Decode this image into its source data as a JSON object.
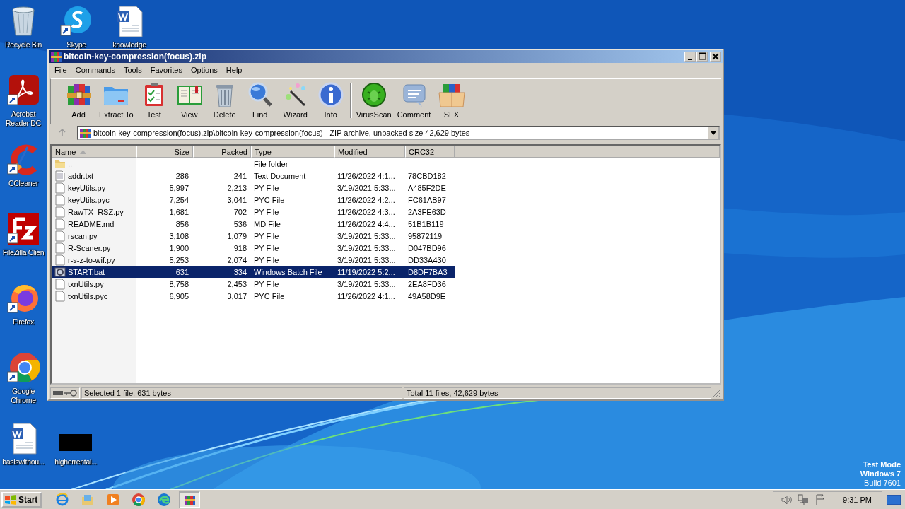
{
  "desktop_icons": [
    {
      "label": "Recycle Bin"
    },
    {
      "label": "Skype"
    },
    {
      "label": "knowledge"
    },
    {
      "label": "Acrobat Reader DC"
    },
    {
      "label": "CCleaner"
    },
    {
      "label": "FileZilla Clien"
    },
    {
      "label": "Firefox"
    },
    {
      "label": "Google Chrome"
    },
    {
      "label": "basiswithou..."
    },
    {
      "label": "higherrental..."
    }
  ],
  "window": {
    "title": "bitcoin-key-compression(focus).zip",
    "menu": [
      "File",
      "Commands",
      "Tools",
      "Favorites",
      "Options",
      "Help"
    ],
    "toolbar": [
      {
        "label": "Add"
      },
      {
        "label": "Extract To"
      },
      {
        "label": "Test"
      },
      {
        "label": "View"
      },
      {
        "label": "Delete"
      },
      {
        "label": "Find"
      },
      {
        "label": "Wizard"
      },
      {
        "label": "Info"
      },
      {
        "label": "VirusScan"
      },
      {
        "label": "Comment"
      },
      {
        "label": "SFX"
      }
    ],
    "address": "bitcoin-key-compression(focus).zip\\bitcoin-key-compression(focus) - ZIP archive, unpacked size 42,629 bytes",
    "columns": [
      "Name",
      "Size",
      "Packed",
      "Type",
      "Modified",
      "CRC32"
    ],
    "rows": [
      {
        "kind": "folder",
        "name": "..",
        "size": "",
        "packed": "",
        "type": "File folder",
        "modified": "",
        "crc32": "",
        "selected": false
      },
      {
        "kind": "text",
        "name": "addr.txt",
        "size": "286",
        "packed": "241",
        "type": "Text Document",
        "modified": "11/26/2022 4:1...",
        "crc32": "78CBD182",
        "selected": false
      },
      {
        "kind": "file",
        "name": "keyUtils.py",
        "size": "5,997",
        "packed": "2,213",
        "type": "PY File",
        "modified": "3/19/2021 5:33...",
        "crc32": "A485F2DE",
        "selected": false
      },
      {
        "kind": "file",
        "name": "keyUtils.pyc",
        "size": "7,254",
        "packed": "3,041",
        "type": "PYC File",
        "modified": "11/26/2022 4:2...",
        "crc32": "FC61AB97",
        "selected": false
      },
      {
        "kind": "file",
        "name": "RawTX_RSZ.py",
        "size": "1,681",
        "packed": "702",
        "type": "PY File",
        "modified": "11/26/2022 4:3...",
        "crc32": "2A3FE63D",
        "selected": false
      },
      {
        "kind": "file",
        "name": "README.md",
        "size": "856",
        "packed": "536",
        "type": "MD File",
        "modified": "11/26/2022 4:4...",
        "crc32": "51B1B119",
        "selected": false
      },
      {
        "kind": "file",
        "name": "rscan.py",
        "size": "3,108",
        "packed": "1,079",
        "type": "PY File",
        "modified": "3/19/2021 5:33...",
        "crc32": "95872119",
        "selected": false
      },
      {
        "kind": "file",
        "name": "R-Scaner.py",
        "size": "1,900",
        "packed": "918",
        "type": "PY File",
        "modified": "3/19/2021 5:33...",
        "crc32": "D047BD96",
        "selected": false
      },
      {
        "kind": "file",
        "name": "r-s-z-to-wif.py",
        "size": "5,253",
        "packed": "2,074",
        "type": "PY File",
        "modified": "3/19/2021 5:33...",
        "crc32": "DD33A430",
        "selected": false
      },
      {
        "kind": "batch",
        "name": "START.bat",
        "size": "631",
        "packed": "334",
        "type": "Windows Batch File",
        "modified": "11/19/2022 5:2...",
        "crc32": "D8DF7BA3",
        "selected": true
      },
      {
        "kind": "file",
        "name": "txnUtils.py",
        "size": "8,758",
        "packed": "2,453",
        "type": "PY File",
        "modified": "3/19/2021 5:33...",
        "crc32": "2EA8FD36",
        "selected": false
      },
      {
        "kind": "file",
        "name": "txnUtils.pyc",
        "size": "6,905",
        "packed": "3,017",
        "type": "PYC File",
        "modified": "11/26/2022 4:1...",
        "crc32": "49A58D9E",
        "selected": false
      }
    ],
    "status_left": "Selected 1 file, 631 bytes",
    "status_right": "Total 11 files, 42,629 bytes"
  },
  "os_notice": [
    "Test Mode",
    "Windows 7",
    "Build 7601"
  ],
  "taskbar": {
    "start": "Start",
    "time": "9:31 PM"
  }
}
